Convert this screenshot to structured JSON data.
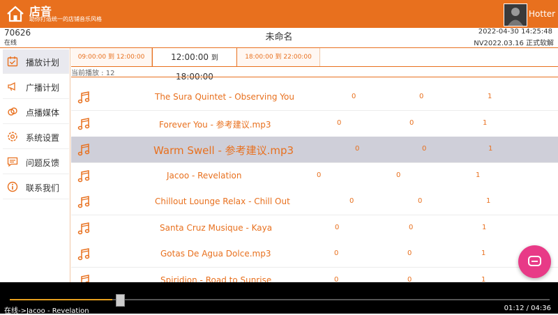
{
  "header": {
    "app_name": "店音",
    "tagline": "助你打造统一的店铺音乐风格",
    "username": "Hotter"
  },
  "status": {
    "device_code": "70626",
    "online_state": "在线",
    "playlist_title": "未命名",
    "datetime": "2022-04-30 14:25:48",
    "version": "NV2022.03.16  正式软解"
  },
  "sidebar": {
    "items": [
      {
        "label": "播放计划",
        "icon": "calendar-check-icon"
      },
      {
        "label": "广播计划",
        "icon": "megaphone-icon"
      },
      {
        "label": "点播媒体",
        "icon": "link-icon"
      },
      {
        "label": "系统设置",
        "icon": "gear-icon"
      },
      {
        "label": "问题反馈",
        "icon": "message-icon"
      },
      {
        "label": "联系我们",
        "icon": "info-icon"
      }
    ]
  },
  "time_slots": [
    {
      "start": "09:00:00",
      "sep": "到",
      "end": "12:00:00"
    },
    {
      "start": "12:00:00",
      "sep": "到",
      "end": "18:00:00"
    },
    {
      "start": "18:00:00",
      "sep": "到",
      "end": "22:00:00"
    }
  ],
  "now_playing_label": "当前播放 : 12",
  "tracks": [
    {
      "name": "The Sura Quintet - Observing You",
      "c1": "0",
      "c2": "0",
      "c3": "1"
    },
    {
      "name": "Forever You - 参考建议.mp3",
      "c1": "0",
      "c2": "0",
      "c3": "1"
    },
    {
      "name": "Warm Swell - 参考建议.mp3",
      "c1": "0",
      "c2": "0",
      "c3": "1"
    },
    {
      "name": "Jacoo - Revelation",
      "c1": "0",
      "c2": "0",
      "c3": "1"
    },
    {
      "name": "Chillout Lounge Relax - Chill Out",
      "c1": "0",
      "c2": "0",
      "c3": "1"
    },
    {
      "name": "Santa Cruz Musique - Kaya",
      "c1": "0",
      "c2": "0",
      "c3": "1"
    },
    {
      "name": "Gotas De Agua Dolce.mp3",
      "c1": "0",
      "c2": "0",
      "c3": "1"
    },
    {
      "name": "Spiridion - Road to Sunrise",
      "c1": "0",
      "c2": "0",
      "c3": "1"
    }
  ],
  "player": {
    "now_playing": "在线->Jacoo - Revelation",
    "time": "01:12 / 04:36",
    "progress": 0.26
  },
  "colors": {
    "accent": "#e8701e",
    "fab": "#e83a87",
    "player_bg": "#000000",
    "progress": "#e8a01e"
  }
}
